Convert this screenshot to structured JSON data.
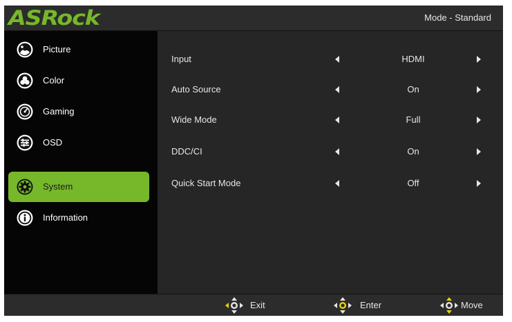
{
  "header": {
    "brand": "ASRock",
    "mode": "Mode - Standard"
  },
  "sidebar": {
    "items": [
      {
        "label": "Picture",
        "icon": "picture-icon",
        "active": false
      },
      {
        "label": "Color",
        "icon": "color-icon",
        "active": false
      },
      {
        "label": "Gaming",
        "icon": "gaming-icon",
        "active": false
      },
      {
        "label": "OSD",
        "icon": "osd-icon",
        "active": false
      },
      {
        "label": "System",
        "icon": "gear-icon",
        "active": true
      },
      {
        "label": "Information",
        "icon": "info-icon",
        "active": false
      }
    ]
  },
  "settings": [
    {
      "label": "Input",
      "value": "HDMI"
    },
    {
      "label": "Auto Source",
      "value": "On"
    },
    {
      "label": "Wide Mode",
      "value": "Full"
    },
    {
      "label": "DDC/CI",
      "value": "On"
    },
    {
      "label": "Quick Start Mode",
      "value": "Off"
    }
  ],
  "footer": {
    "exit_label": "Exit",
    "enter_label": "Enter",
    "move_label": "Move"
  },
  "colors": {
    "accent": "#76b82a",
    "background": "#262626",
    "sidebar": "#050505",
    "highlight_yellow": "#e8d400"
  }
}
